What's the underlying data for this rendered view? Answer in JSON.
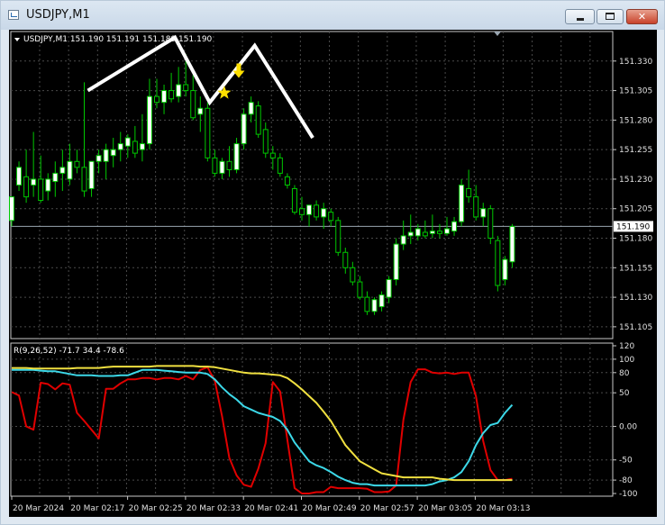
{
  "window": {
    "title": "USDJPY,M1",
    "buttons": [
      "minimize-icon",
      "maximize-icon",
      "close-icon"
    ]
  },
  "colors": {
    "background": "#000000",
    "grid": "#4a4a4a",
    "bull_candle": "#ffffff",
    "wick": "#00c800",
    "price_line": "#9aa6b0",
    "macd_red": "#e00000",
    "macd_cyan": "#3cd8e8",
    "macd_yellow": "#f0e040",
    "arrow": "#ffe000",
    "drawing": "#ffffff"
  },
  "chart_data": [
    {
      "type": "candlestick",
      "symbol_label": "USDJPY,M1  151.190 151.191 151.189 151.190",
      "ylim": [
        151.095,
        151.355
      ],
      "yticks": [
        "151.330",
        "151.305",
        "151.280",
        "151.255",
        "151.230",
        "151.205",
        "151.180",
        "151.155",
        "151.130",
        "151.105"
      ],
      "current_price": "151.190",
      "xticks": [
        "20 Mar 2024",
        "20 Mar 02:17",
        "20 Mar 02:25",
        "20 Mar 02:33",
        "20 Mar 02:41",
        "20 Mar 02:49",
        "20 Mar 02:57",
        "20 Mar 03:05",
        "20 Mar 03:13"
      ],
      "candles": [
        {
          "o": 151.195,
          "h": 151.215,
          "l": 151.19,
          "c": 151.215
        },
        {
          "o": 151.225,
          "h": 151.245,
          "l": 151.22,
          "c": 151.24
        },
        {
          "o": 151.232,
          "h": 151.255,
          "l": 151.21,
          "c": 151.215
        },
        {
          "o": 151.225,
          "h": 151.27,
          "l": 151.215,
          "c": 151.23
        },
        {
          "o": 151.23,
          "h": 151.25,
          "l": 151.21,
          "c": 151.212
        },
        {
          "o": 151.22,
          "h": 151.235,
          "l": 151.212,
          "c": 151.23
        },
        {
          "o": 151.228,
          "h": 151.245,
          "l": 151.215,
          "c": 151.235
        },
        {
          "o": 151.235,
          "h": 151.255,
          "l": 151.22,
          "c": 151.24
        },
        {
          "o": 151.23,
          "h": 151.26,
          "l": 151.225,
          "c": 151.245
        },
        {
          "o": 151.245,
          "h": 151.255,
          "l": 151.235,
          "c": 151.24
        },
        {
          "o": 151.24,
          "h": 151.312,
          "l": 151.215,
          "c": 151.22
        },
        {
          "o": 151.222,
          "h": 151.245,
          "l": 151.215,
          "c": 151.245
        },
        {
          "o": 151.245,
          "h": 151.255,
          "l": 151.235,
          "c": 151.25
        },
        {
          "o": 151.245,
          "h": 151.26,
          "l": 151.23,
          "c": 151.255
        },
        {
          "o": 151.25,
          "h": 151.265,
          "l": 151.24,
          "c": 151.255
        },
        {
          "o": 151.255,
          "h": 151.27,
          "l": 151.245,
          "c": 151.26
        },
        {
          "o": 151.258,
          "h": 151.268,
          "l": 151.248,
          "c": 151.265
        },
        {
          "o": 151.262,
          "h": 151.275,
          "l": 151.248,
          "c": 151.252
        },
        {
          "o": 151.255,
          "h": 151.285,
          "l": 151.245,
          "c": 151.26
        },
        {
          "o": 151.26,
          "h": 151.315,
          "l": 151.255,
          "c": 151.3
        },
        {
          "o": 151.3,
          "h": 151.315,
          "l": 151.29,
          "c": 151.295
        },
        {
          "o": 151.295,
          "h": 151.31,
          "l": 151.285,
          "c": 151.305
        },
        {
          "o": 151.305,
          "h": 151.32,
          "l": 151.295,
          "c": 151.298
        },
        {
          "o": 151.3,
          "h": 151.325,
          "l": 151.295,
          "c": 151.31
        },
        {
          "o": 151.31,
          "h": 151.336,
          "l": 151.3,
          "c": 151.305
        },
        {
          "o": 151.305,
          "h": 151.318,
          "l": 151.28,
          "c": 151.282
        },
        {
          "o": 151.285,
          "h": 151.3,
          "l": 151.27,
          "c": 151.29
        },
        {
          "o": 151.29,
          "h": 151.295,
          "l": 151.245,
          "c": 151.248
        },
        {
          "o": 151.248,
          "h": 151.255,
          "l": 151.232,
          "c": 151.235
        },
        {
          "o": 151.235,
          "h": 151.248,
          "l": 151.23,
          "c": 151.245
        },
        {
          "o": 151.245,
          "h": 151.258,
          "l": 151.232,
          "c": 151.238
        },
        {
          "o": 151.238,
          "h": 151.265,
          "l": 151.235,
          "c": 151.26
        },
        {
          "o": 151.26,
          "h": 151.29,
          "l": 151.255,
          "c": 151.285
        },
        {
          "o": 151.285,
          "h": 151.3,
          "l": 151.278,
          "c": 151.295
        },
        {
          "o": 151.292,
          "h": 151.296,
          "l": 151.265,
          "c": 151.268
        },
        {
          "o": 151.272,
          "h": 151.278,
          "l": 151.248,
          "c": 151.252
        },
        {
          "o": 151.252,
          "h": 151.258,
          "l": 151.238,
          "c": 151.248
        },
        {
          "o": 151.248,
          "h": 151.252,
          "l": 151.232,
          "c": 151.235
        },
        {
          "o": 151.232,
          "h": 151.235,
          "l": 151.222,
          "c": 151.225
        },
        {
          "o": 151.222,
          "h": 151.225,
          "l": 151.2,
          "c": 151.202
        },
        {
          "o": 151.205,
          "h": 151.215,
          "l": 151.195,
          "c": 151.2
        },
        {
          "o": 151.2,
          "h": 151.208,
          "l": 151.19,
          "c": 151.208
        },
        {
          "o": 151.208,
          "h": 151.212,
          "l": 151.195,
          "c": 151.198
        },
        {
          "o": 151.198,
          "h": 151.21,
          "l": 151.188,
          "c": 151.205
        },
        {
          "o": 151.202,
          "h": 151.205,
          "l": 151.19,
          "c": 151.195
        },
        {
          "o": 151.195,
          "h": 151.198,
          "l": 151.165,
          "c": 151.168
        },
        {
          "o": 151.168,
          "h": 151.172,
          "l": 151.15,
          "c": 151.155
        },
        {
          "o": 151.155,
          "h": 151.16,
          "l": 151.14,
          "c": 151.143
        },
        {
          "o": 151.143,
          "h": 151.148,
          "l": 151.128,
          "c": 151.13
        },
        {
          "o": 151.13,
          "h": 151.135,
          "l": 151.115,
          "c": 151.118
        },
        {
          "o": 151.118,
          "h": 151.13,
          "l": 151.115,
          "c": 151.128
        },
        {
          "o": 151.122,
          "h": 151.135,
          "l": 151.118,
          "c": 151.132
        },
        {
          "o": 151.13,
          "h": 151.148,
          "l": 151.125,
          "c": 151.145
        },
        {
          "o": 151.145,
          "h": 151.18,
          "l": 151.14,
          "c": 151.175
        },
        {
          "o": 151.175,
          "h": 151.195,
          "l": 151.17,
          "c": 151.182
        },
        {
          "o": 151.182,
          "h": 151.2,
          "l": 151.175,
          "c": 151.185
        },
        {
          "o": 151.182,
          "h": 151.192,
          "l": 151.178,
          "c": 151.188
        },
        {
          "o": 151.185,
          "h": 151.195,
          "l": 151.18,
          "c": 151.182
        },
        {
          "o": 151.184,
          "h": 151.2,
          "l": 151.18,
          "c": 151.186
        },
        {
          "o": 151.186,
          "h": 151.192,
          "l": 151.18,
          "c": 151.184
        },
        {
          "o": 151.184,
          "h": 151.198,
          "l": 151.182,
          "c": 151.188
        },
        {
          "o": 151.186,
          "h": 151.198,
          "l": 151.182,
          "c": 151.194
        },
        {
          "o": 151.194,
          "h": 151.23,
          "l": 151.19,
          "c": 151.225
        },
        {
          "o": 151.222,
          "h": 151.238,
          "l": 151.21,
          "c": 151.215
        },
        {
          "o": 151.215,
          "h": 151.225,
          "l": 151.195,
          "c": 151.198
        },
        {
          "o": 151.198,
          "h": 151.21,
          "l": 151.19,
          "c": 151.205
        },
        {
          "o": 151.205,
          "h": 151.208,
          "l": 151.175,
          "c": 151.18
        },
        {
          "o": 151.178,
          "h": 151.182,
          "l": 151.135,
          "c": 151.14
        },
        {
          "o": 151.145,
          "h": 151.165,
          "l": 151.14,
          "c": 151.162
        },
        {
          "o": 151.16,
          "h": 151.192,
          "l": 151.155,
          "c": 151.19
        }
      ],
      "drawing_zigzag": [
        {
          "i": 10.5,
          "price": 151.305
        },
        {
          "i": 22.5,
          "price": 151.35
        },
        {
          "i": 27.3,
          "price": 151.295
        },
        {
          "i": 33.5,
          "price": 151.343
        },
        {
          "i": 41.5,
          "price": 151.265
        }
      ]
    },
    {
      "type": "line",
      "indicator_label": "R(9,26,52) -71.7 34.4 -78.6",
      "ylim": [
        -104,
        124
      ],
      "yticks": [
        "120",
        "100",
        "80",
        "50",
        "0.00",
        "-50",
        "-80",
        "-100"
      ],
      "series": [
        {
          "color": "red",
          "values": [
            51,
            46,
            0,
            -5,
            65,
            63,
            55,
            64,
            62,
            20,
            8,
            -5,
            -18,
            56,
            56,
            64,
            70,
            70,
            72,
            72,
            70,
            72,
            72,
            70,
            75,
            70,
            84,
            88,
            68,
            15,
            -47,
            -73,
            -87,
            -90,
            -63,
            -25,
            66,
            52,
            -20,
            -92,
            -100,
            -100,
            -98,
            -98,
            -90,
            -92,
            -92,
            -92,
            -92,
            -93,
            -98,
            -98,
            -97,
            -88,
            10,
            66,
            85,
            85,
            80,
            79,
            80,
            78,
            80,
            80,
            45,
            -22,
            -65,
            -80,
            -80,
            -78
          ]
        },
        {
          "color": "cyan",
          "values": [
            84,
            84,
            84,
            84,
            83,
            82,
            82,
            80,
            78,
            76,
            76,
            76,
            75,
            75,
            75,
            76,
            76,
            80,
            84,
            84,
            84,
            83,
            82,
            81,
            80,
            80,
            80,
            78,
            70,
            58,
            48,
            40,
            30,
            25,
            20,
            17,
            14,
            8,
            -5,
            -24,
            -38,
            -52,
            -58,
            -62,
            -68,
            -75,
            -80,
            -84,
            -86,
            -86,
            -88,
            -88,
            -88,
            -88,
            -88,
            -88,
            -88,
            -88,
            -86,
            -82,
            -80,
            -76,
            -68,
            -52,
            -28,
            -10,
            2,
            5,
            20,
            32
          ]
        },
        {
          "color": "yellow",
          "values": [
            87,
            87,
            87,
            86,
            86,
            86,
            86,
            86,
            86,
            87,
            87,
            87,
            87,
            88,
            89,
            89,
            89,
            89,
            89,
            89,
            90,
            90,
            90,
            90,
            90,
            90,
            89,
            89,
            88,
            86,
            84,
            82,
            80,
            79,
            79,
            78,
            77,
            76,
            72,
            64,
            55,
            45,
            35,
            22,
            8,
            -10,
            -28,
            -40,
            -52,
            -58,
            -64,
            -70,
            -72,
            -74,
            -76,
            -76,
            -76,
            -76,
            -76,
            -78,
            -79,
            -80,
            -80,
            -80,
            -80,
            -80,
            -80,
            -80,
            -80,
            -80
          ]
        }
      ]
    }
  ]
}
